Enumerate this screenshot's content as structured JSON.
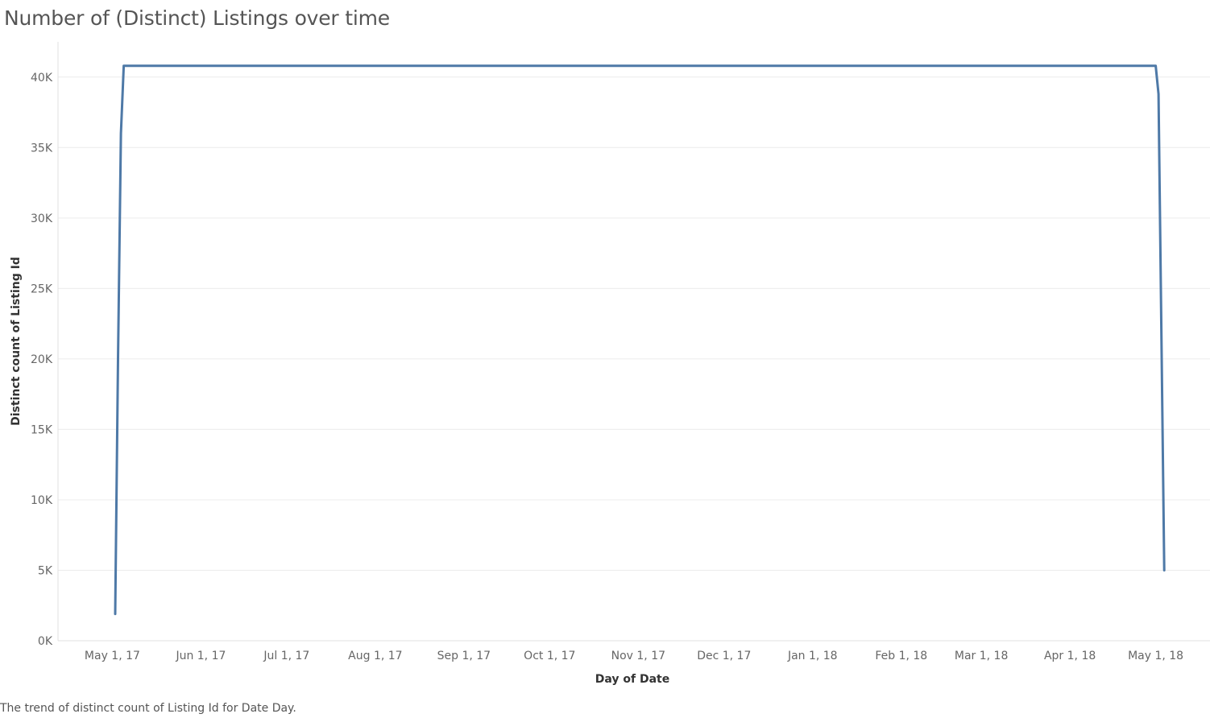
{
  "title": "Number of (Distinct) Listings over time",
  "caption": "The trend of distinct count of Listing Id for Date Day.",
  "chart_data": {
    "type": "line",
    "xlabel": "Day of Date",
    "ylabel": "Distinct count of Listing Id",
    "ylim": [
      0,
      42500
    ],
    "xlim": [
      "2017-04-12",
      "2018-05-20"
    ],
    "yticks": [
      {
        "value": 0,
        "label": "0K"
      },
      {
        "value": 5000,
        "label": "5K"
      },
      {
        "value": 10000,
        "label": "10K"
      },
      {
        "value": 15000,
        "label": "15K"
      },
      {
        "value": 20000,
        "label": "20K"
      },
      {
        "value": 25000,
        "label": "25K"
      },
      {
        "value": 30000,
        "label": "30K"
      },
      {
        "value": 35000,
        "label": "35K"
      },
      {
        "value": 40000,
        "label": "40K"
      }
    ],
    "xticks": [
      {
        "date": "2017-05-01",
        "label": "May 1, 17"
      },
      {
        "date": "2017-06-01",
        "label": "Jun 1, 17"
      },
      {
        "date": "2017-07-01",
        "label": "Jul 1, 17"
      },
      {
        "date": "2017-08-01",
        "label": "Aug 1, 17"
      },
      {
        "date": "2017-09-01",
        "label": "Sep 1, 17"
      },
      {
        "date": "2017-10-01",
        "label": "Oct 1, 17"
      },
      {
        "date": "2017-11-01",
        "label": "Nov 1, 17"
      },
      {
        "date": "2017-12-01",
        "label": "Dec 1, 17"
      },
      {
        "date": "2018-01-01",
        "label": "Jan 1, 18"
      },
      {
        "date": "2018-02-01",
        "label": "Feb 1, 18"
      },
      {
        "date": "2018-03-01",
        "label": "Mar 1, 18"
      },
      {
        "date": "2018-04-01",
        "label": "Apr 1, 18"
      },
      {
        "date": "2018-05-01",
        "label": "May 1, 18"
      }
    ],
    "grid": true,
    "series": [
      {
        "color": "#4e79a7",
        "points": [
          {
            "x": "2017-05-02",
            "y": 1900
          },
          {
            "x": "2017-05-03",
            "y": 20000
          },
          {
            "x": "2017-05-04",
            "y": 36000
          },
          {
            "x": "2017-05-05",
            "y": 40800
          },
          {
            "x": "2018-05-01",
            "y": 40800
          },
          {
            "x": "2018-05-02",
            "y": 38800
          },
          {
            "x": "2018-05-04",
            "y": 5000
          }
        ]
      }
    ]
  },
  "colors": {
    "line": "#4e79a7",
    "grid": "#ececec",
    "axis": "#e0e0e0"
  }
}
